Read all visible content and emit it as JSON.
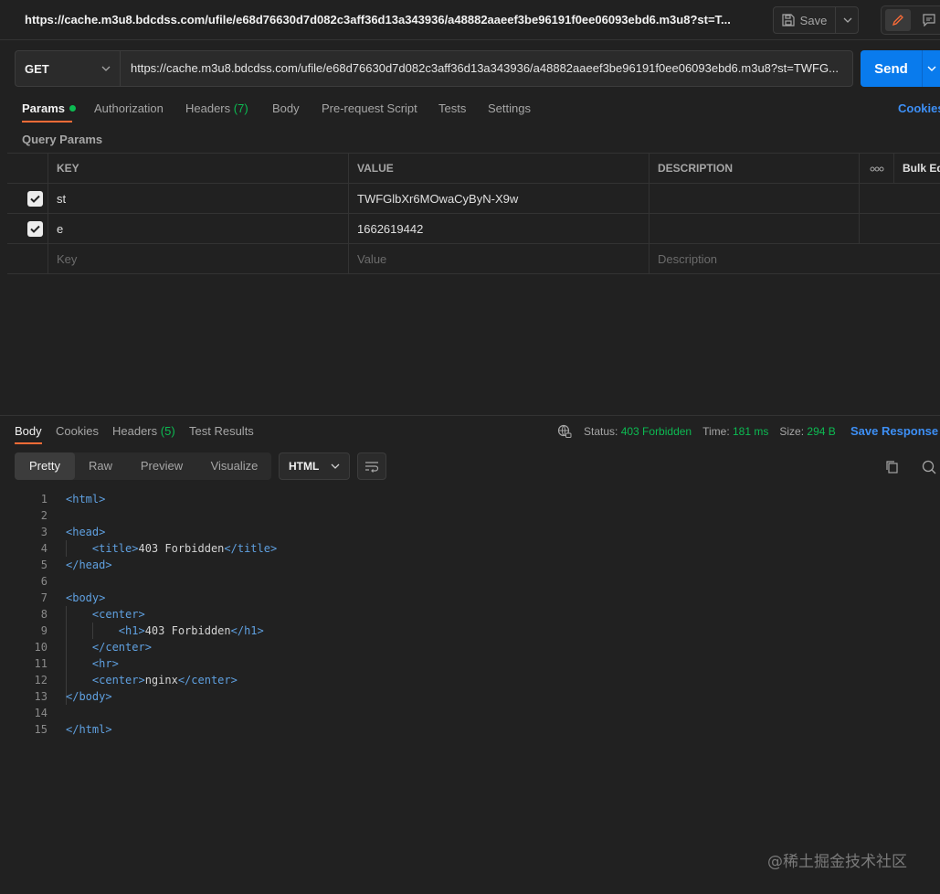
{
  "header": {
    "request_title": "https://cache.m3u8.bdcdss.com/ufile/e68d76630d7d082c3aff36d13a343936/a48882aaeef3be96191f0ee06093ebd6.m3u8?st=T...",
    "save_label": "Save"
  },
  "request": {
    "method": "GET",
    "url": "https://cache.m3u8.bdcdss.com/ufile/e68d76630d7d082c3aff36d13a343936/a48882aaeef3be96191f0ee06093ebd6.m3u8?st=TWFG...",
    "send_label": "Send"
  },
  "request_tabs": {
    "params": "Params",
    "authorization": "Authorization",
    "headers": "Headers",
    "headers_count": "(7)",
    "body": "Body",
    "pre_request": "Pre-request Script",
    "tests": "Tests",
    "settings": "Settings",
    "cookies": "Cookies"
  },
  "query_params": {
    "title": "Query Params",
    "columns": [
      "KEY",
      "VALUE",
      "DESCRIPTION"
    ],
    "bulk_edit": "Bulk Ed",
    "rows": [
      {
        "checked": true,
        "key": "st",
        "value": "TWFGlbXr6MOwaCyByN-X9w",
        "description": ""
      },
      {
        "checked": true,
        "key": "e",
        "value": "1662619442",
        "description": ""
      }
    ],
    "placeholder": {
      "key": "Key",
      "value": "Value",
      "description": "Description"
    }
  },
  "response_tabs": {
    "body": "Body",
    "cookies": "Cookies",
    "headers": "Headers",
    "headers_count": "(5)",
    "test_results": "Test Results"
  },
  "response_status": {
    "status_label": "Status:",
    "status_value": "403 Forbidden",
    "time_label": "Time:",
    "time_value": "181 ms",
    "size_label": "Size:",
    "size_value": "294 B",
    "save_response": "Save Response"
  },
  "view_modes": [
    "Pretty",
    "Raw",
    "Preview",
    "Visualize"
  ],
  "active_view": "Pretty",
  "language": "HTML",
  "code_lines": [
    "<html>",
    "",
    "<head>",
    "    <title>403 Forbidden</title>",
    "</head>",
    "",
    "<body>",
    "    <center>",
    "        <h1>403 Forbidden</h1>",
    "    </center>",
    "    <hr>",
    "    <center>nginx</center>",
    "</body>",
    "",
    "</html>"
  ],
  "watermark": "@稀土掘金技术社区",
  "colors": {
    "accent": "#ff6c37",
    "send": "#097bed",
    "success": "#0cbb52",
    "link": "#3d8ff5",
    "tag": "#5fa0e0"
  }
}
